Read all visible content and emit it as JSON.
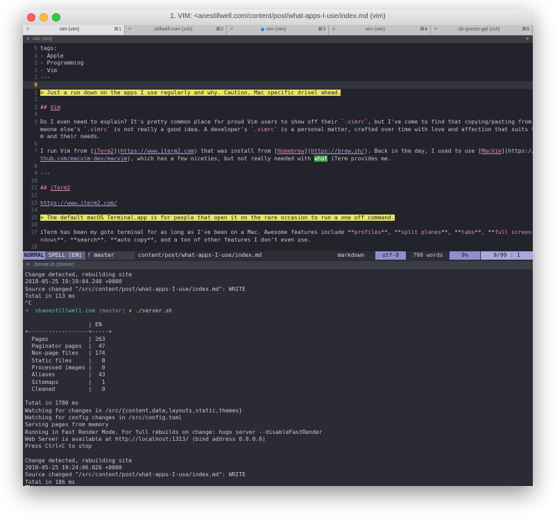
{
  "window": {
    "title": "1. VIM: <anestillwell.com/content/post/what-apps-I-use/index.md  (vim)"
  },
  "tabs": [
    {
      "label": "vim (vim)",
      "shortcut": "⌘1",
      "active": true,
      "dot": false
    },
    {
      "label": "...stillwell.com (zsh)",
      "shortcut": "⌘2",
      "active": false,
      "dot": false
    },
    {
      "label": "vim (vim)",
      "shortcut": "⌘3",
      "active": false,
      "dot": true
    },
    {
      "label": "vim (vim)",
      "shortcut": "⌘4",
      "active": false,
      "dot": false
    },
    {
      "label": "...dx-guests-gql (zsh)",
      "shortcut": "⌘5",
      "active": false,
      "dot": false
    }
  ],
  "top_pane": {
    "title": "vim (vim)"
  },
  "bottom_pane": {
    "title": "./server.sh (docker)"
  },
  "editor": {
    "lines": [
      {
        "n": "5",
        "t": "tags:"
      },
      {
        "n": "4",
        "t": "- Apple"
      },
      {
        "n": "3",
        "t": "- Programming"
      },
      {
        "n": "2",
        "t": "- Vim"
      },
      {
        "n": "1",
        "t": "---"
      },
      {
        "n": "9",
        "t": ""
      },
      {
        "n": "1",
        "t": "> Just a run down on the apps I use regularly and why. Caution, Mac specific drivel ahead."
      },
      {
        "n": "2",
        "t": ""
      },
      {
        "n": "3",
        "t": "## Vim"
      },
      {
        "n": "4",
        "t": ""
      },
      {
        "n": "5",
        "t": "Do I even need to explain? It's pretty common place for proud Vim users to show off their `.vimrc`, but I've come to find that copying/pasting from so"
      },
      {
        "n": "",
        "t": "meone else's `.vimrc` is not really a good idea. A developer's `.vimrc` is a personal matter, crafted over time with love and affection that suits the"
      },
      {
        "n": "",
        "t": "m and their needs."
      },
      {
        "n": "6",
        "t": ""
      },
      {
        "n": "7",
        "t": "I run Vim from [iTerm2](https://www.iterm2.com) that was install from [Homebrew](https://brew.sh/). Back in the day, I used to use [MacVim](https://gi"
      },
      {
        "n": "",
        "t": "thub.com/macvim-dev/macvim), which has a few niceties, but not really needed with what iTerm provides me."
      },
      {
        "n": "8",
        "t": ""
      },
      {
        "n": "9",
        "t": "---"
      },
      {
        "n": "10",
        "t": ""
      },
      {
        "n": "11",
        "t": "## iTerm2"
      },
      {
        "n": "12",
        "t": ""
      },
      {
        "n": "13",
        "t": "https://www.iterm2.com/"
      },
      {
        "n": "14",
        "t": ""
      },
      {
        "n": "15",
        "t": "> The default macOS Terminal.app is for people that open it on the rare occasion to run a one off command."
      },
      {
        "n": "16",
        "t": ""
      },
      {
        "n": "17",
        "t": "iTerm has been my goto terminal for as long as I've been on a Mac. Awesome features include **profiles**, **split planes**, **tabs**, **full screen wi"
      },
      {
        "n": "",
        "t": "ndows**, **search**, **auto copy**, and a ton of other features I don't even use."
      },
      {
        "n": "18",
        "t": ""
      },
      {
        "n": "19",
        "t": "---"
      }
    ]
  },
  "statusline": {
    "mode": "NORMAL",
    "spell": "SPELL [EN]",
    "branch": "ᚠ master",
    "path": "content/post/what-apps-I-use/index.md",
    "filetype": "markdown",
    "encoding": "utf-8",
    "words": "790 words",
    "percent": "9%",
    "position": "9/99  :  1"
  },
  "terminal": {
    "lines": [
      "Change detected, rebuilding site",
      "2018-05-25 19:19:04.240 +0000",
      "Source changed \"/src/content/post/what-apps-I-use/index.md\": WRITE",
      "Total in 113 ms",
      "^C",
      "",
      "",
      "                   | EN",
      "+------------------+-----+",
      "  Pages            | 263",
      "  Paginator pages  |  47",
      "  Non-page files   | 174",
      "  Static files     |   8",
      "  Processed images |   0",
      "  Aliases          |  43",
      "  Sitemaps         |   1",
      "  Cleaned          |   0",
      "",
      "Total in 1780 ms",
      "Watching for changes in /src/{content,data,layouts,static,themes}",
      "Watching for config changes in /src/config.toml",
      "Serving pages from memory",
      "Running in Fast Render Mode. For full rebuilds on change: hugo server --disableFastRender",
      "Web Server is available at http://localhost:1313/ (bind address 0.0.0.0)",
      "Press Ctrl+C to stop",
      "",
      "Change detected, rebuilding site",
      "2018-05-25 19:24:06.026 +0000",
      "Source changed \"/src/content/post/what-apps-I-use/index.md\": WRITE",
      "Total in 186 ms"
    ],
    "prompt_arrow": "➜",
    "prompt_host": "shanestillwell.com",
    "prompt_branch": "(master)",
    "prompt_mark": "✗",
    "prompt_cmd": "./server.sh"
  }
}
